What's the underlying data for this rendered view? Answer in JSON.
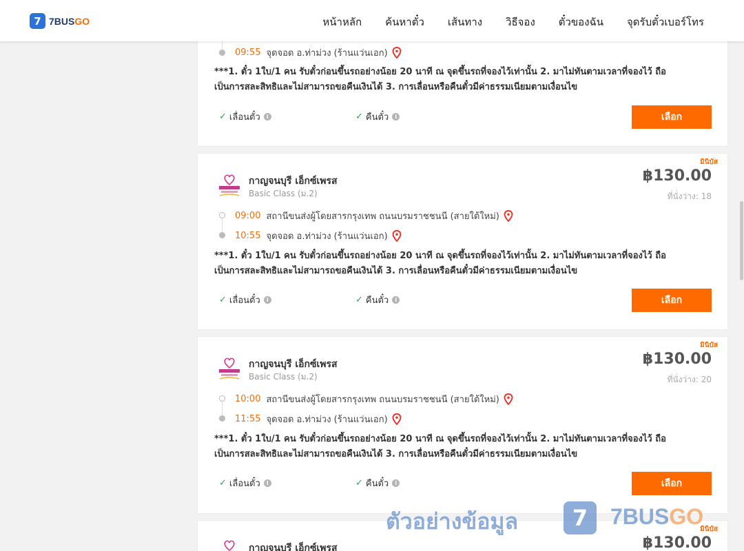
{
  "header": {
    "logo_mark": "7",
    "logo_part1": "7BUS",
    "logo_part2": "GO",
    "nav": [
      "หน้าหลัก",
      "ค้นหาตั๋ว",
      "เส้นทาง",
      "วิธีจอง",
      "ตั๋วของฉัน",
      "จุดรับตั๋วเบอร์โทร"
    ]
  },
  "colors": {
    "accent": "#ff6a00",
    "brand_blue": "#2b73d8",
    "check_green": "#2aa84a",
    "pin_red": "#e8372c"
  },
  "cards": [
    {
      "arrival_time": "09:55",
      "arrival_place": "จุดจอด อ.ท่าม่วง (ร้านแว่นเอก)",
      "policy_line1": "***1. ตั๋ว 1ใบ/1 คน รับตั๋วก่อนขึ้นรถอย่างน้อย 20 นาที ณ จุดขึ้นรถที่จองไว้เท่านั้น 2. มาไม่ทันตามเวลาที่จองไว้ ถือ",
      "policy_line2": "เป็นการสละสิทธิและไม่สามารถขอคืนเงินได้ 3. การเลื่อนหรือคืนตั๋วมีค่าธรรมเนียมตามเงื่อนไข",
      "perk_change": "เลื่อนตั๋ว",
      "perk_refund": "คืนตั๋ว",
      "button": "เลือก"
    },
    {
      "tag": "มินิบัส",
      "company": "กาญจนบุรี เอ็กซ์เพรส",
      "class": "Basic Class (ม.2)",
      "price": "฿130.00",
      "seats": "ที่นั่งว่าง: 18",
      "departure_time": "09:00",
      "departure_place": "สถานีขนส่งผู้โดยสารกรุงเทพ ถนนบรมราชชนนี (สายใต้ใหม่)",
      "arrival_time": "10:55",
      "arrival_place": "จุดจอด อ.ท่าม่วง (ร้านแว่นเอก)",
      "policy_line1": "***1. ตั๋ว 1ใบ/1 คน รับตั๋วก่อนขึ้นรถอย่างน้อย 20 นาที ณ จุดขึ้นรถที่จองไว้เท่านั้น 2. มาไม่ทันตามเวลาที่จองไว้ ถือ",
      "policy_line2": "เป็นการสละสิทธิและไม่สามารถขอคืนเงินได้ 3. การเลื่อนหรือคืนตั๋วมีค่าธรรมเนียมตามเงื่อนไข",
      "perk_change": "เลื่อนตั๋ว",
      "perk_refund": "คืนตั๋ว",
      "button": "เลือก"
    },
    {
      "tag": "มินิบัส",
      "company": "กาญจนบุรี เอ็กซ์เพรส",
      "class": "Basic Class (ม.2)",
      "price": "฿130.00",
      "seats": "ที่นั่งว่าง: 20",
      "departure_time": "10:00",
      "departure_place": "สถานีขนส่งผู้โดยสารกรุงเทพ ถนนบรมราชชนนี (สายใต้ใหม่)",
      "arrival_time": "11:55",
      "arrival_place": "จุดจอด อ.ท่าม่วง (ร้านแว่นเอก)",
      "policy_line1": "***1. ตั๋ว 1ใบ/1 คน รับตั๋วก่อนขึ้นรถอย่างน้อย 20 นาที ณ จุดขึ้นรถที่จองไว้เท่านั้น 2. มาไม่ทันตามเวลาที่จองไว้ ถือ",
      "policy_line2": "เป็นการสละสิทธิและไม่สามารถขอคืนเงินได้ 3. การเลื่อนหรือคืนตั๋วมีค่าธรรมเนียมตามเงื่อนไข",
      "perk_change": "เลื่อนตั๋ว",
      "perk_refund": "คืนตั๋ว",
      "button": "เลือก"
    },
    {
      "tag": "มินิบัส",
      "company": "กาญจนบุรี เอ็กซ์เพรส",
      "price": "฿130.00"
    }
  ],
  "watermark": {
    "text": "ตัวอย่างข้อมูล",
    "mark": "7",
    "logo_part1": "7BUS",
    "logo_part2": "GO"
  }
}
